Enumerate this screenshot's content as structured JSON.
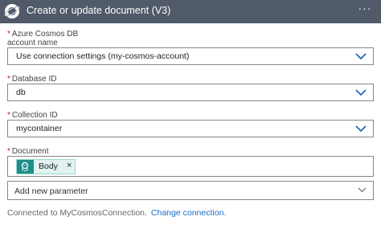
{
  "header": {
    "title": "Create or update document (V3)",
    "more_label": "···",
    "bg_color": "#505a68",
    "logo_icon": "planet-icon"
  },
  "fields": [
    {
      "label_line1": "Azure Cosmos DB",
      "label_line2": "account name",
      "required_mark": "*",
      "value": "Use connection settings (my-cosmos-account)"
    },
    {
      "label": "Database ID",
      "required_mark": "*",
      "value": "db"
    },
    {
      "label": "Collection ID",
      "required_mark": "*",
      "value": "mycontainer"
    },
    {
      "label": "Document",
      "required_mark": "*",
      "token": {
        "label": "Body",
        "close": "×",
        "icon": "dynamic-content-icon",
        "color": "#1f8e89"
      }
    }
  ],
  "add_parameter": {
    "label": "Add new parameter"
  },
  "footer": {
    "text": "Connected to MyCosmosConnection.",
    "link": "Change connection."
  },
  "accent_color": "#1a6ec8",
  "required_color": "#c8102e"
}
